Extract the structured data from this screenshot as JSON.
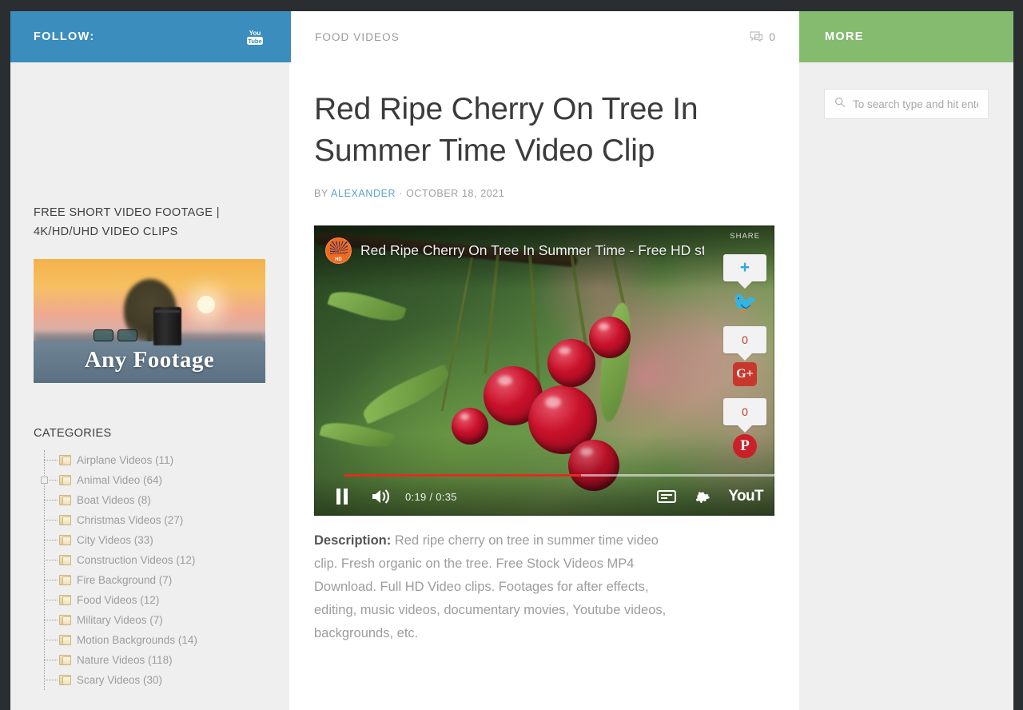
{
  "theme": {
    "accent_blue": "#3a8dbd",
    "accent_green": "#85bb6f",
    "frame_dark": "#2a2e31",
    "sidebar_bg": "#efefef",
    "link_blue": "#5ba3cc",
    "youtube_red": "#e02d20"
  },
  "follow_bar": {
    "label": "FOLLOW:",
    "social_icon": "youtube-icon"
  },
  "center_bar": {
    "category": "FOOD VIDEOS",
    "comment_icon": "comment-icon",
    "comment_count": "0"
  },
  "more_bar": {
    "label": "MORE"
  },
  "left_sidebar": {
    "footage_widget": {
      "title": "FREE SHORT VIDEO FOOTAGE | 4K/HD/UHD VIDEO CLIPS",
      "banner_text": "Any Footage"
    },
    "categories_widget": {
      "title": "CATEGORIES",
      "items": [
        {
          "label": "Airplane Videos (11)",
          "expandable": false
        },
        {
          "label": "Animal Video (64)",
          "expandable": true
        },
        {
          "label": "Boat Videos (8)",
          "expandable": false
        },
        {
          "label": "Christmas Videos (27)",
          "expandable": false
        },
        {
          "label": "City Videos (33)",
          "expandable": false
        },
        {
          "label": "Construction Videos (12)",
          "expandable": false
        },
        {
          "label": "Fire Background (7)",
          "expandable": false
        },
        {
          "label": "Food Videos (12)",
          "expandable": false
        },
        {
          "label": "Military Videos (7)",
          "expandable": false
        },
        {
          "label": "Motion Backgrounds (14)",
          "expandable": false
        },
        {
          "label": "Nature Videos (118)",
          "expandable": false
        },
        {
          "label": "Scary Videos (30)",
          "expandable": false
        }
      ]
    }
  },
  "article": {
    "title": "Red Ripe Cherry On Tree In Summer Time Video Clip",
    "meta_by": "BY",
    "author": "ALEXANDER",
    "meta_sep": "·",
    "date": "OCTOBER 18, 2021",
    "description_label": "Description:",
    "description_text": " Red ripe cherry on tree in summer time video clip. Fresh organic on the tree. Free Stock Videos MP4 Download. Full HD Video clips. Footages for after effects, editing, music videos, documentary movies, Youtube videos, backgrounds, etc."
  },
  "player": {
    "channel_avatar_label": "orange",
    "channel_avatar_sub": "HD",
    "video_title": "Red Ripe Cherry On Tree In Summer Time - Free HD stock fo...",
    "share_label": "SHARE",
    "current_time": "0:19",
    "separator": "/",
    "duration": "0:35",
    "progress_percent": 55,
    "pause_icon": "pause-icon",
    "volume_icon": "volume-icon",
    "captions_icon": "closed-captions-icon",
    "settings_icon": "gear-icon",
    "wordmark": "YouT"
  },
  "share_widget": {
    "twitter": {
      "icon": "twitter-icon",
      "bubble": "+"
    },
    "google_plus": {
      "icon": "google-plus-icon",
      "bubble": "0",
      "glyph": "G+"
    },
    "pinterest": {
      "icon": "pinterest-icon",
      "bubble": "0",
      "glyph": "P"
    }
  },
  "right_sidebar": {
    "search": {
      "icon": "search-icon",
      "placeholder": "To search type and hit enter",
      "value": ""
    }
  }
}
